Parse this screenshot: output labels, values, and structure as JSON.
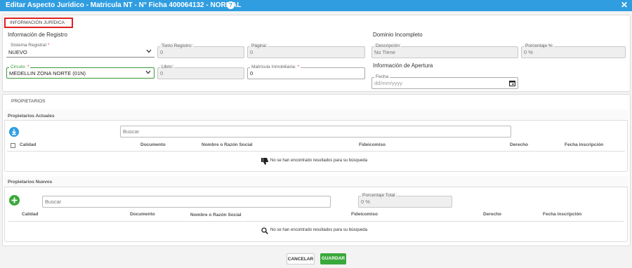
{
  "window": {
    "title": "Editar Aspecto Jurídico - Matricula NT - N° Ficha 400064132 - NORMAL",
    "help_glyph": "?",
    "close_glyph": "✕"
  },
  "juridica": {
    "tab_label": "INFORMACIÓN JURÍDICA",
    "registro_title": "Información de Registro",
    "sistema_registral": {
      "label": "Sistema Registral",
      "required": "*",
      "value": "NUEVO"
    },
    "tomo_registro": {
      "label": "Tomo Registro:",
      "value": "0"
    },
    "pagina": {
      "label": "Página:",
      "value": "0"
    },
    "circulo": {
      "label": "Circulo:",
      "required": "*",
      "value": "MEDELLIN ZONA NORTE (01N)"
    },
    "libro": {
      "label": "Libro:",
      "value": "0"
    },
    "matricula_inmobiliaria": {
      "label": "Matrícula Inmobiliaria:",
      "required": "*",
      "value": "0"
    },
    "dominio_title": "Dominio Incompleto",
    "descripcion": {
      "label": "Descripción",
      "value": "No Tiene"
    },
    "porcentaje": {
      "label": "Porcentaje %",
      "value": "0 %"
    },
    "apertura_title": "Información de Apertura",
    "fecha": {
      "label": "Fecha",
      "placeholder": "dd/mm/yyyy"
    }
  },
  "propietarios": {
    "tab_label": "PROPIETARIOS",
    "actuales": {
      "title": "Propietarios Actuales",
      "search_placeholder": "Buscar",
      "columns": [
        "Calidad",
        "Documento",
        "Nombre o Razón Social",
        "Fideicomiso",
        "Derecho",
        "Fecha inscripción"
      ],
      "empty_message": "No se han encontrado resultados para su búsqueda"
    },
    "nuevos": {
      "title": "Propietarios Nuevos",
      "search_placeholder": "Buscar",
      "porcentaje_total": {
        "label": "Porcentaje Total",
        "value": "0 %"
      },
      "columns": [
        "Calidad",
        "Documento",
        "Nombre o Razón Social",
        "Fideicomiso",
        "Derecho",
        "Fecha inscripción"
      ],
      "empty_message": "No se han encontrado resultados para su búsqueda"
    }
  },
  "footer": {
    "cancel_label": "CANCELAR",
    "save_label": "GUARDAR"
  },
  "colors": {
    "titlebar": "#2f9de0",
    "highlight_box": "#e02020",
    "download_button": "#2f9de0",
    "add_button": "#3aa83a",
    "save_button": "#3aa83a"
  }
}
